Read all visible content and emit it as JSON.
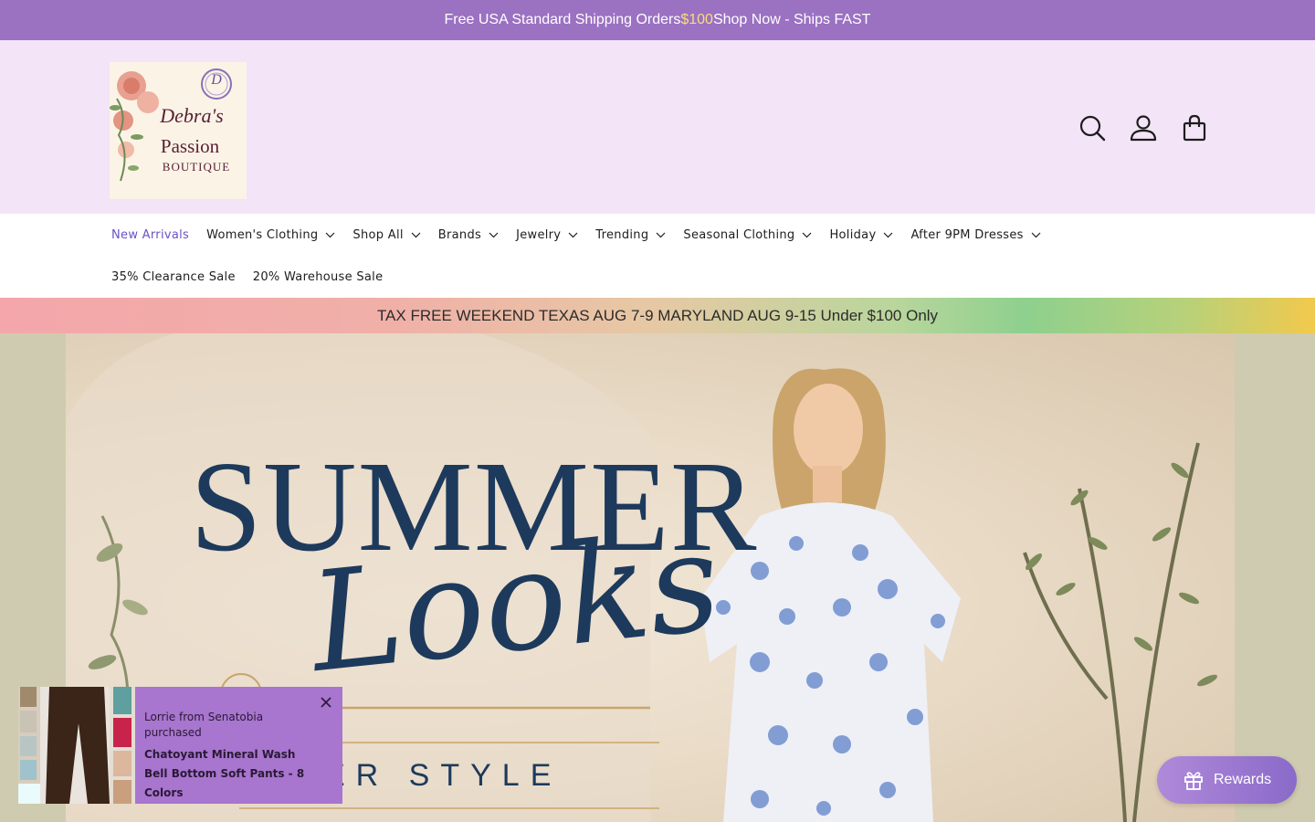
{
  "announcement": {
    "text_before": "Free USA Standard Shipping Orders ",
    "accent_amount": "$100",
    "text_after": " Shop Now - Ships FAST"
  },
  "header": {
    "logo": {
      "line1": "Debra's",
      "line2": "Passion",
      "line3": "BOUTIQUE",
      "monogram": "D"
    },
    "icons": [
      "search-icon",
      "account-icon",
      "cart-icon"
    ]
  },
  "nav": {
    "row1": [
      {
        "label": "New Arrivals",
        "dropdown": false,
        "active": true
      },
      {
        "label": "Women's Clothing",
        "dropdown": true
      },
      {
        "label": "Shop All",
        "dropdown": true
      },
      {
        "label": "Brands",
        "dropdown": true
      },
      {
        "label": "Jewelry",
        "dropdown": true
      },
      {
        "label": "Trending",
        "dropdown": true
      },
      {
        "label": "Seasonal Clothing",
        "dropdown": true
      },
      {
        "label": "Holiday",
        "dropdown": true
      },
      {
        "label": "After 9PM Dresses",
        "dropdown": true
      }
    ],
    "row2": [
      {
        "label": "35% Clearance Sale",
        "dropdown": false
      },
      {
        "label": "20% Warehouse Sale",
        "dropdown": false
      }
    ]
  },
  "promo_bar": {
    "text": "TAX FREE WEEKEND TEXAS AUG 7-9 MARYLAND AUG 9-15 Under $100 Only"
  },
  "hero": {
    "line1": "SUMMER",
    "line2": "Looks",
    "subline": "MPER STYLE"
  },
  "purchase_popup": {
    "who": "Lorrie from Senatobia purchased",
    "product": "Chatoyant Mineral Wash Bell Bottom Soft Pants - 8 Colors"
  },
  "rewards": {
    "label": "Rewards"
  },
  "colors": {
    "announcement_bg": "#9b71c2",
    "header_bg": "#f3e4f8",
    "nav_active": "#6b52c4",
    "hero_text": "#1d3a5c",
    "popup_bg": "#a875cf"
  }
}
